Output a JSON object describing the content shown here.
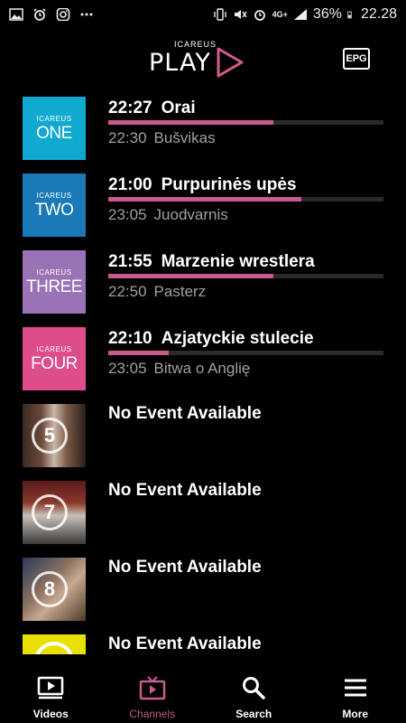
{
  "status_bar": {
    "left_icons": [
      "image-icon",
      "alarm-icon",
      "instagram-icon",
      "more-dots-icon"
    ],
    "network": "4G+",
    "battery": "36%",
    "time": "22.28"
  },
  "header": {
    "logo_small": "ICAREUS",
    "logo_big": "PLAY",
    "epg_label": "EPG"
  },
  "channels": [
    {
      "brand": "ICAREUS",
      "name": "ONE",
      "color": "#10a9cf",
      "now_time": "22:27",
      "now_title": "Orai",
      "progress": 0.6,
      "next_time": "22:30",
      "next_title": "Bušvikas"
    },
    {
      "brand": "ICAREUS",
      "name": "TWO",
      "color": "#1a7ab8",
      "now_time": "21:00",
      "now_title": "Purpurinės upės",
      "progress": 0.7,
      "next_time": "23:05",
      "next_title": "Juodvarnis"
    },
    {
      "brand": "ICAREUS",
      "name": "THREE",
      "color": "#9a72b6",
      "now_time": "21:55",
      "now_title": "Marzenie wrestlera",
      "progress": 0.6,
      "next_time": "22:50",
      "next_title": "Pasterz"
    },
    {
      "brand": "ICAREUS",
      "name": "FOUR",
      "color": "#de4c8c",
      "now_time": "22:10",
      "now_title": "Azjatyckie stulecie",
      "progress": 0.22,
      "next_time": "23:05",
      "next_title": "Bitwa o Anglię"
    },
    {
      "channel_number": "5",
      "no_event": "No Event Available"
    },
    {
      "channel_number": "7",
      "no_event": "No Event Available"
    },
    {
      "channel_number": "8",
      "no_event": "No Event Available"
    },
    {
      "channel_number": "",
      "no_event": "No Event Available"
    }
  ],
  "bottom_nav": [
    {
      "label": "Videos",
      "icon": "videos-icon",
      "active": false
    },
    {
      "label": "Channels",
      "icon": "tv-icon",
      "active": true
    },
    {
      "label": "Search",
      "icon": "search-icon",
      "active": false
    },
    {
      "label": "More",
      "icon": "menu-icon",
      "active": false
    }
  ],
  "colors": {
    "accent": "#c85a8e",
    "background": "#000000",
    "secondary_text": "#a0a0a0"
  }
}
